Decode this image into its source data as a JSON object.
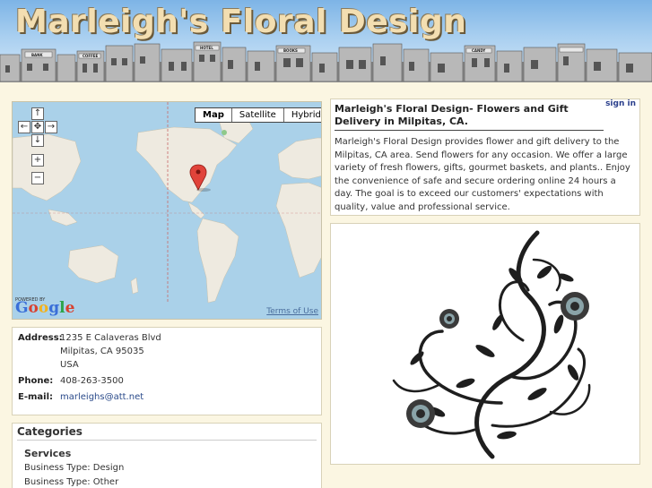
{
  "site": {
    "title": "Marleigh's Floral Design"
  },
  "map": {
    "type_buttons": [
      "Map",
      "Satellite",
      "Hybrid"
    ],
    "active_type": "Map",
    "powered_by": "POWERED BY",
    "logo_text": "Google",
    "terms_label": "Terms of Use",
    "controls": {
      "up": "↑",
      "left": "←",
      "center": "✥",
      "right": "→",
      "down": "↓",
      "zoom_in": "+",
      "zoom_out": "−"
    }
  },
  "address": {
    "address_label": "Address:",
    "lines": [
      "1235 E Calaveras Blvd",
      "Milpitas, CA 95035",
      "USA"
    ],
    "phone_label": "Phone:",
    "phone": "408-263-3500",
    "email_label": "E-mail:",
    "email": "marleighs@att.net"
  },
  "categories": {
    "title": "Categories",
    "heading": "Services",
    "items": [
      "Business Type: Design",
      "Business Type: Other"
    ]
  },
  "description": {
    "sign_in": "sign in",
    "title": "Marleigh's Floral Design- Flowers and Gift Delivery in Milpitas, CA.",
    "text": "Marleigh's Floral Design provides flower and gift delivery to the Milpitas, CA area. Send flowers for any occasion. We offer a large variety of fresh flowers, gifts, gourmet baskets, and plants.. Enjoy the convenience of safe and secure ordering online 24 hours a day. The goal is to exceed our customers' expectations with quality, value and professional service."
  },
  "banner_signs": [
    "BANK",
    "COFFEE",
    "HOTEL",
    "BOOKS",
    "CANDY"
  ],
  "colors": {
    "header_sky": "#a9cff0",
    "title": "#f3deb1",
    "page_bg": "#fbf6e2",
    "link": "#2a3f8c",
    "ocean": "#aad1e9",
    "land": "#eeeae0"
  }
}
